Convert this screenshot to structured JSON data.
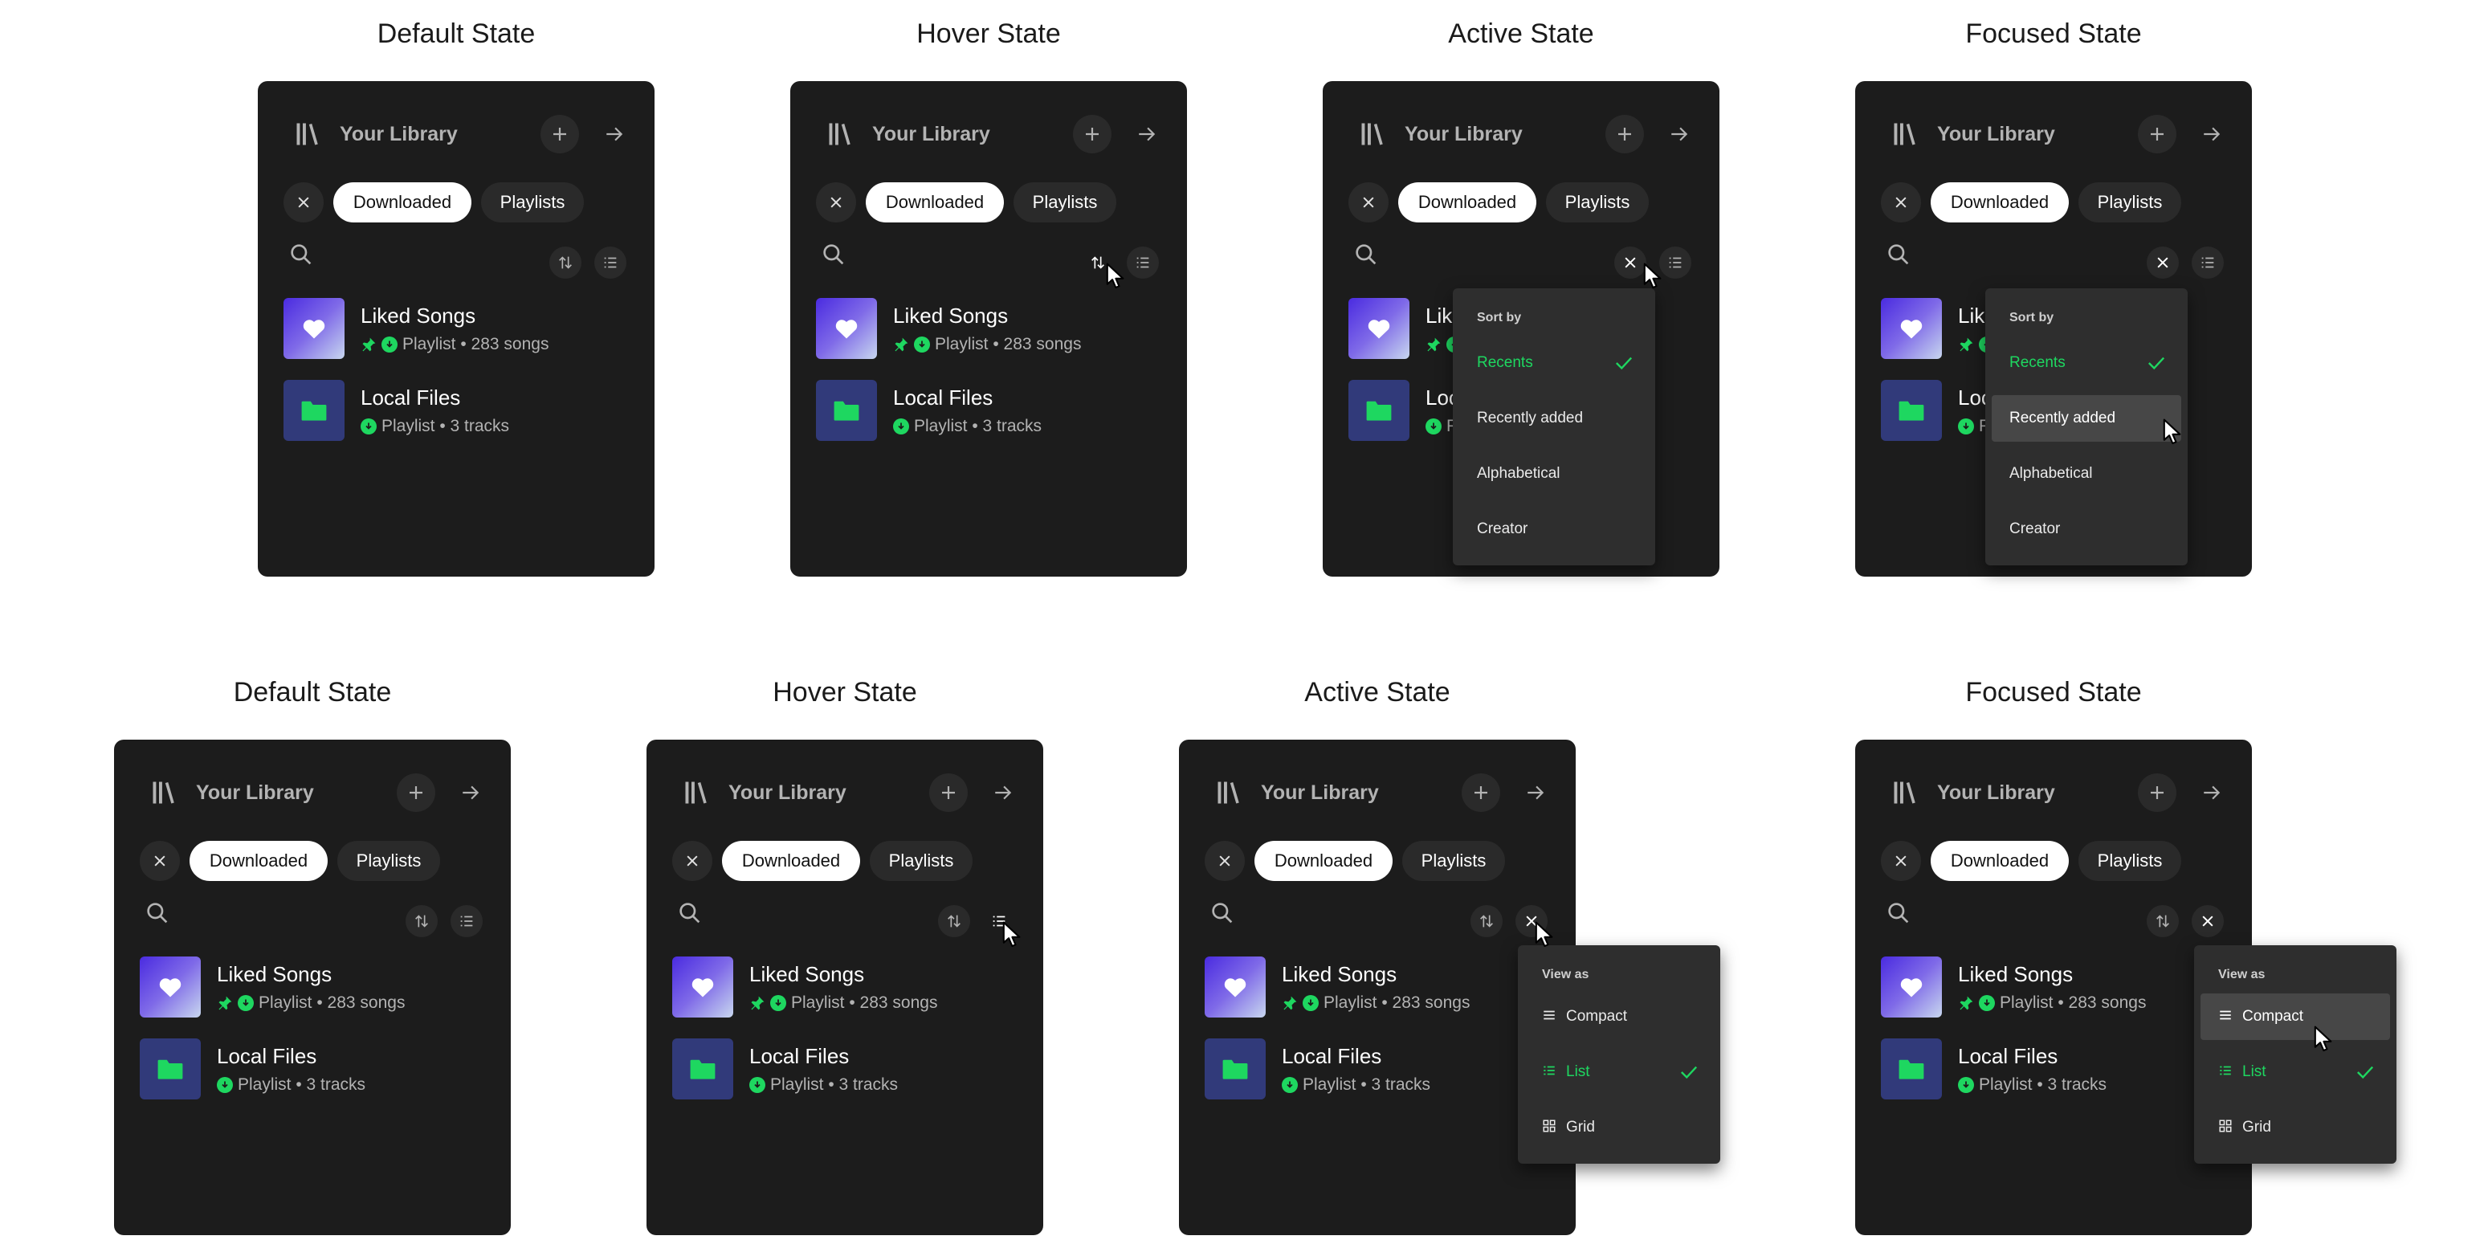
{
  "titles": {
    "default": "Default State",
    "hover": "Hover State",
    "active": "Active State",
    "focused": "Focused State"
  },
  "library": {
    "title": "Your Library",
    "chips": {
      "downloaded": "Downloaded",
      "playlists": "Playlists"
    },
    "items": [
      {
        "title": "Liked Songs",
        "subtitle": "Playlist • 283 songs",
        "pinned": true,
        "icon": "heart-icon"
      },
      {
        "title": "Local Files",
        "subtitle": "Playlist • 3 tracks",
        "pinned": false,
        "icon": "folder-icon"
      }
    ]
  },
  "sort_menu": {
    "header": "Sort by",
    "options": [
      "Recents",
      "Recently added",
      "Alphabetical",
      "Creator"
    ],
    "selected": "Recents"
  },
  "view_menu": {
    "header": "View as",
    "options": [
      "Compact",
      "List",
      "Grid"
    ],
    "selected": "List"
  },
  "colors": {
    "panel": "#1c1c1c",
    "accent_green": "#1ed760",
    "menu_bg": "#2e2e2e",
    "focus_bg": "#474747"
  }
}
